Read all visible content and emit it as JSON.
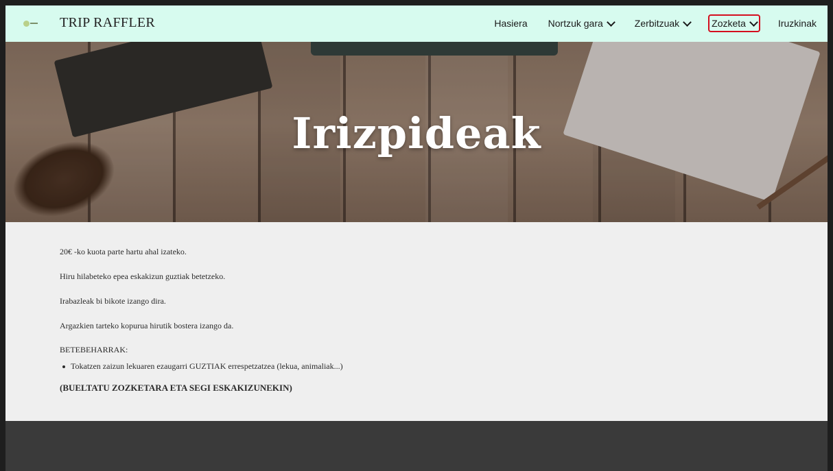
{
  "header": {
    "site_title": "TRIP RAFFLER",
    "nav": [
      {
        "label": "Hasiera",
        "has_dropdown": false,
        "active": false
      },
      {
        "label": "Nortzuk gara",
        "has_dropdown": true,
        "active": false
      },
      {
        "label": "Zerbitzuak",
        "has_dropdown": true,
        "active": false
      },
      {
        "label": "Zozketa",
        "has_dropdown": true,
        "active": true
      },
      {
        "label": "Iruzkinak",
        "has_dropdown": false,
        "active": false
      }
    ]
  },
  "hero": {
    "title": "Irizpideak"
  },
  "content": {
    "paragraphs": [
      "20€ -ko kuota parte hartu ahal izateko.",
      "Hiru hilabeteko epea eskakizun guztiak betetzeko.",
      "Irabazleak bi bikote izango dira.",
      "Argazkien tarteko kopurua hirutik bostera izango da."
    ],
    "requirements_heading": "BETEBEHARRAK:",
    "requirements": [
      "Tokatzen zaizun lekuaren ezaugarri GUZTIAK errespetzatzea (lekua, animaliak...)"
    ],
    "closing": "(BUELTATU ZOZKETARA ETA SEGI ESKAKIZUNEKIN)"
  },
  "colors": {
    "header_bg": "#d7fbef",
    "active_outline": "#d40e1e",
    "page_bg": "#efefef",
    "footer_bg": "#3a3a3a"
  }
}
